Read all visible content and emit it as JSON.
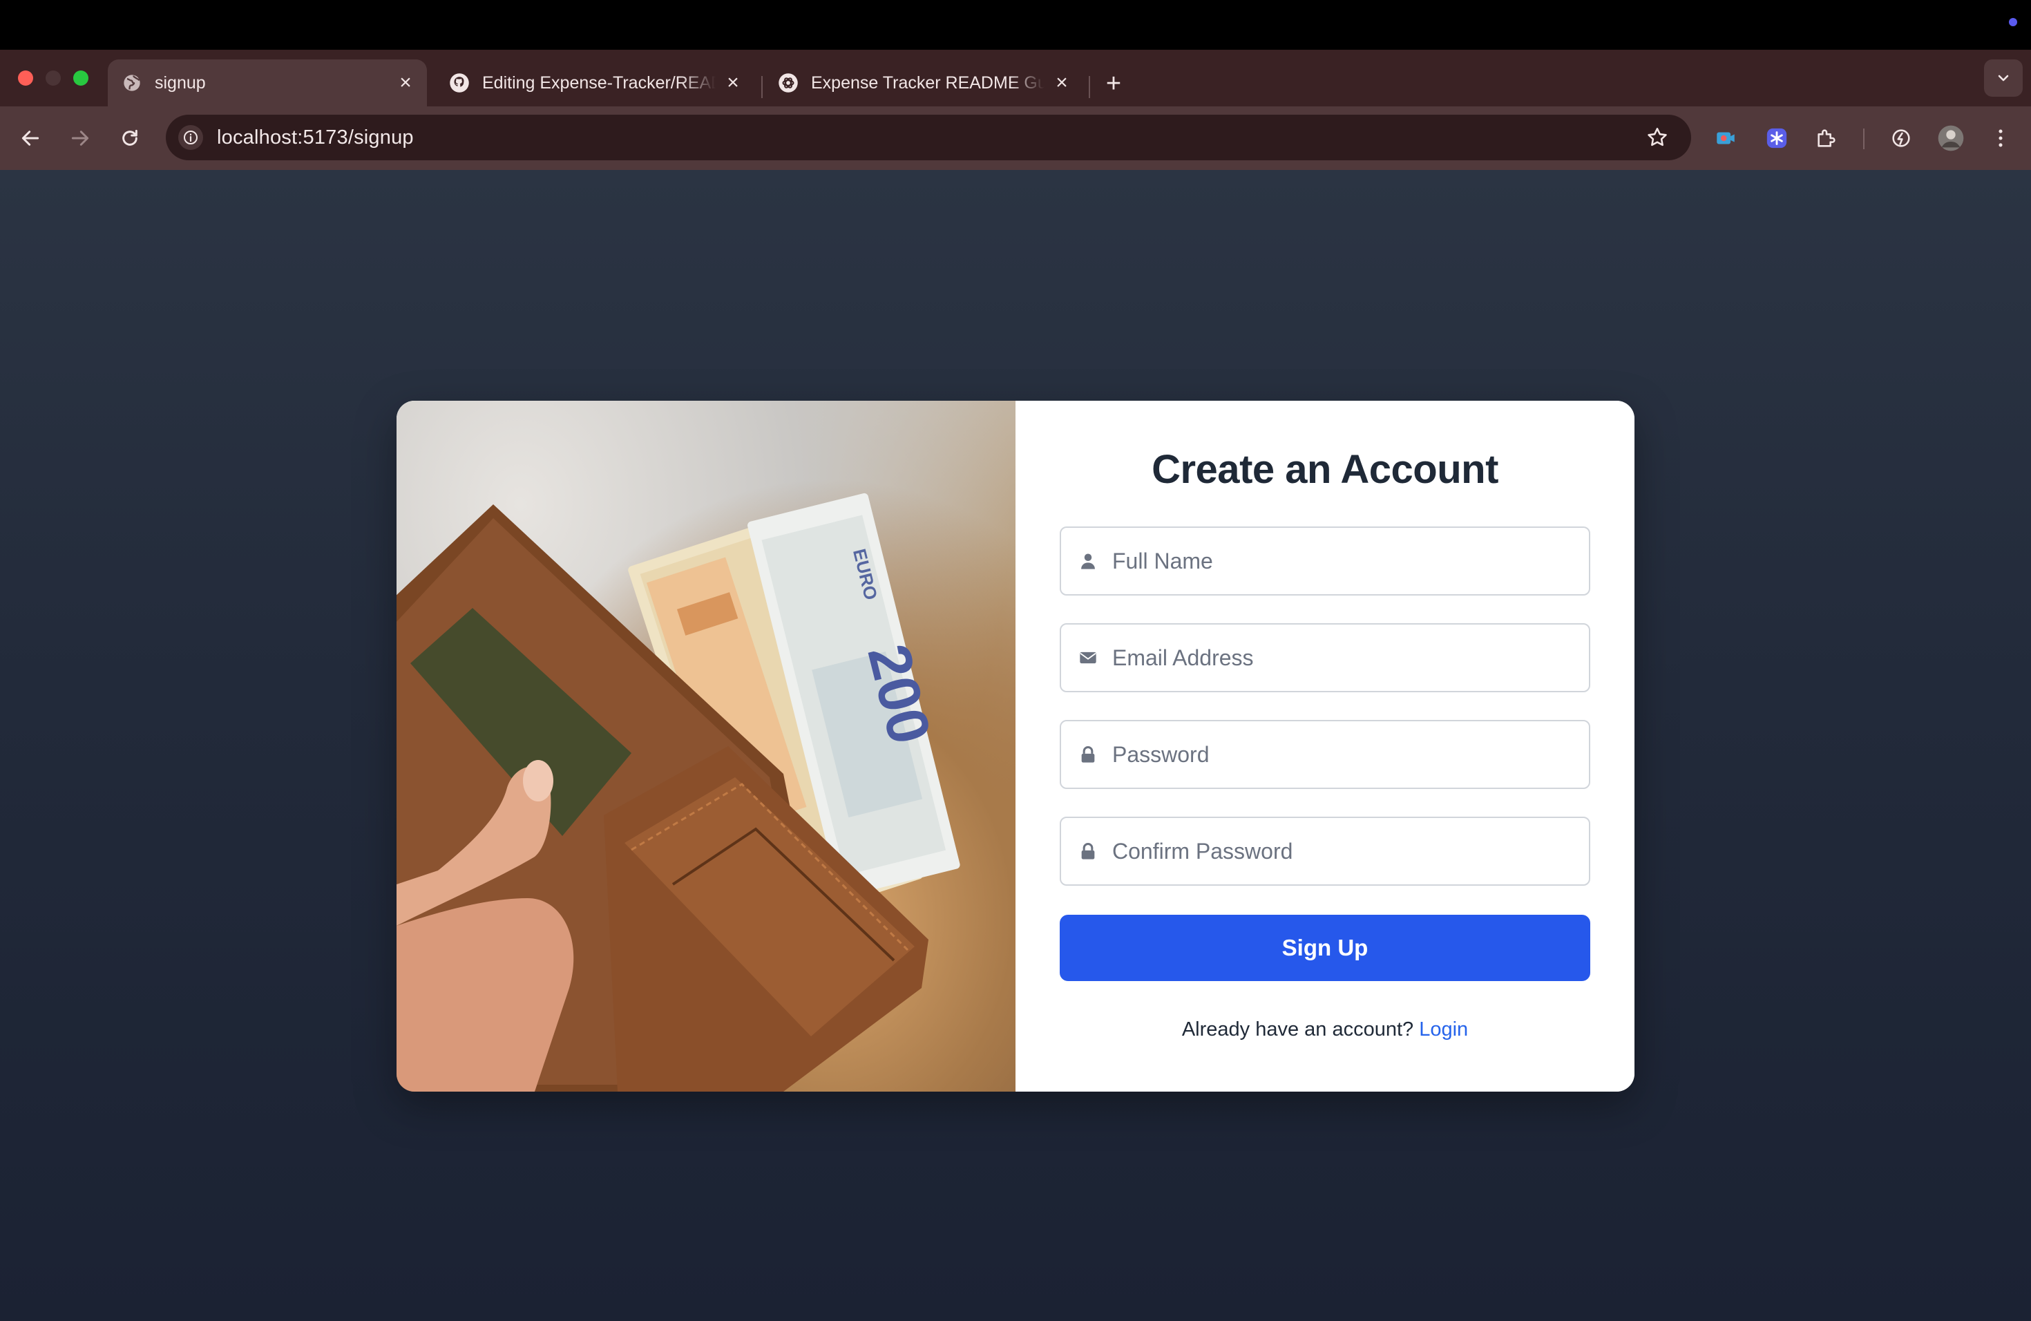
{
  "browser": {
    "tabs": [
      {
        "title": "signup",
        "active": true,
        "favicon": "globe-icon"
      },
      {
        "title": "Editing Expense-Tracker/README.md",
        "active": false,
        "favicon": "github-icon"
      },
      {
        "title": "Expense Tracker README Guide",
        "active": false,
        "favicon": "openai-icon"
      }
    ],
    "url": "localhost:5173/signup"
  },
  "signup": {
    "title": "Create an Account",
    "fields": {
      "full_name": {
        "placeholder": "Full Name",
        "value": ""
      },
      "email": {
        "placeholder": "Email Address",
        "value": ""
      },
      "password": {
        "placeholder": "Password",
        "value": ""
      },
      "confirm_password": {
        "placeholder": "Confirm Password",
        "value": ""
      }
    },
    "submit_label": "Sign Up",
    "login_prompt": "Already have an account?",
    "login_link": "Login"
  },
  "photo": {
    "banknote_label": "EURO",
    "banknote_value": "200"
  },
  "colors": {
    "primary": "#2658eb",
    "link": "#2563eb",
    "heading": "#1f2937",
    "page_bg": "#222a3a",
    "chrome_bg": "#3a2224"
  }
}
